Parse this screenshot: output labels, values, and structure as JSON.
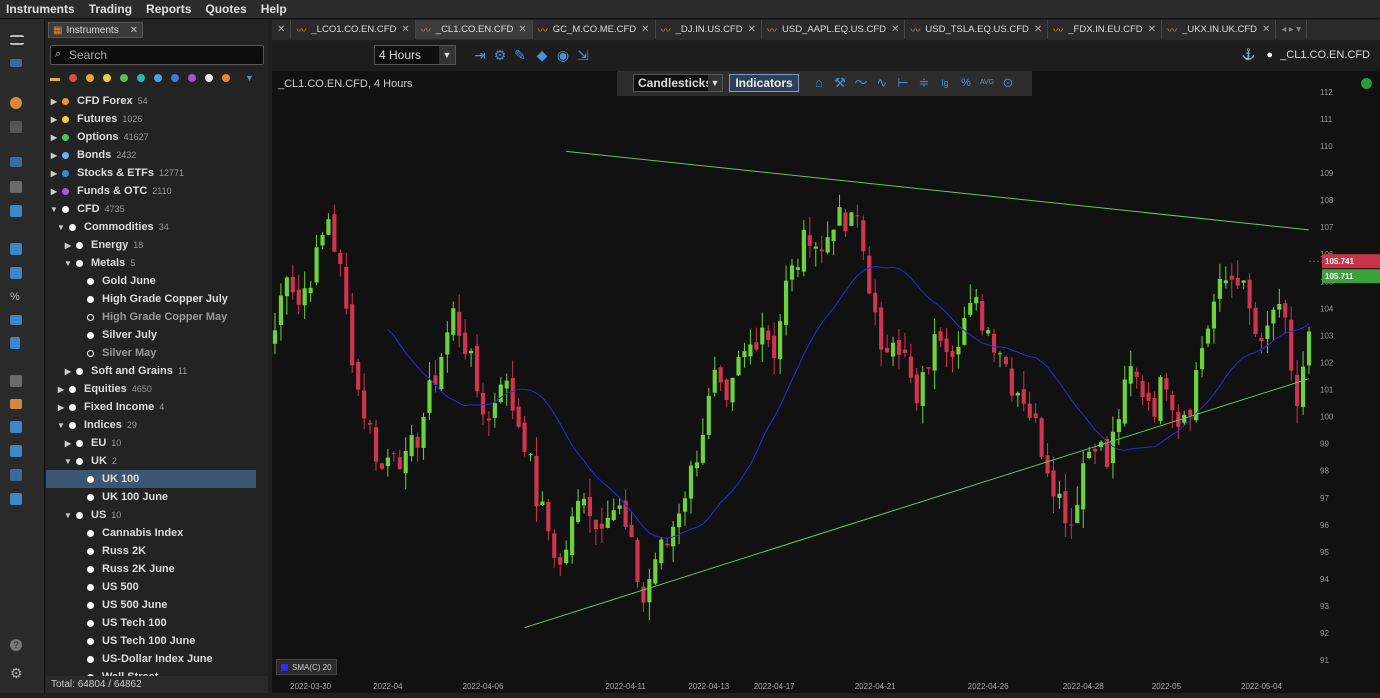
{
  "menu": [
    "Instruments",
    "Trading",
    "Reports",
    "Quotes",
    "Help"
  ],
  "panel": {
    "tab_label": "Instruments",
    "search_placeholder": "Search",
    "filter_colors": [
      "#d94f3d",
      "#e8a633",
      "#e8d133",
      "#5cb85c",
      "#2fb9a0",
      "#4aa3df",
      "#3a7fd6",
      "#a04fd6",
      "#eeeeee",
      "#e8853a"
    ],
    "tree": [
      {
        "level": 0,
        "arrow": "▶",
        "dot": "#f0902f",
        "label": "CFD Forex",
        "count": "54"
      },
      {
        "level": 0,
        "arrow": "▶",
        "dot": "#f3cf3a",
        "label": "Futures",
        "count": "1026"
      },
      {
        "level": 0,
        "arrow": "▶",
        "dot": "#4cc16a",
        "label": "Options",
        "count": "41627"
      },
      {
        "level": 0,
        "arrow": "▶",
        "dot": "#67b4ea",
        "label": "Bonds",
        "count": "2432"
      },
      {
        "level": 0,
        "arrow": "▶",
        "dot": "#3e88c9",
        "label": "Stocks & ETFs",
        "count": "12771"
      },
      {
        "level": 0,
        "arrow": "▶",
        "dot": "#b25ad6",
        "label": "Funds & OTC",
        "count": "2110"
      },
      {
        "level": 0,
        "arrow": "▼",
        "dot": "#ffffff",
        "label": "CFD",
        "count": "4735"
      },
      {
        "level": 1,
        "arrow": "▼",
        "dot": "#ffffff",
        "label": "Commodities",
        "count": "34"
      },
      {
        "level": 2,
        "arrow": "▶",
        "dot": "#ffffff",
        "label": "Energy",
        "count": "18"
      },
      {
        "level": 2,
        "arrow": "▼",
        "dot": "#ffffff",
        "label": "Metals",
        "count": "5"
      },
      {
        "level": 3,
        "arrow": "",
        "dot": "#ffffff",
        "label": "Gold June",
        "count": ""
      },
      {
        "level": 3,
        "arrow": "",
        "dot": "#ffffff",
        "label": "High Grade Copper July",
        "count": ""
      },
      {
        "level": 3,
        "arrow": "",
        "dot": "hollow",
        "label": "High Grade Copper May",
        "count": "",
        "dim": true
      },
      {
        "level": 3,
        "arrow": "",
        "dot": "#ffffff",
        "label": "Silver July",
        "count": ""
      },
      {
        "level": 3,
        "arrow": "",
        "dot": "hollow",
        "label": "Silver May",
        "count": "",
        "dim": true
      },
      {
        "level": 2,
        "arrow": "▶",
        "dot": "#ffffff",
        "label": "Soft and Grains",
        "count": "11"
      },
      {
        "level": 1,
        "arrow": "▶",
        "dot": "#ffffff",
        "label": "Equities",
        "count": "4650"
      },
      {
        "level": 1,
        "arrow": "▶",
        "dot": "#ffffff",
        "label": "Fixed Income",
        "count": "4"
      },
      {
        "level": 1,
        "arrow": "▼",
        "dot": "#ffffff",
        "label": "Indices",
        "count": "29"
      },
      {
        "level": 2,
        "arrow": "▶",
        "dot": "#ffffff",
        "label": "EU",
        "count": "10"
      },
      {
        "level": 2,
        "arrow": "▼",
        "dot": "#ffffff",
        "label": "UK",
        "count": "2"
      },
      {
        "level": 3,
        "arrow": "",
        "dot": "#ffffff",
        "label": "UK 100",
        "count": "",
        "selected": true
      },
      {
        "level": 3,
        "arrow": "",
        "dot": "#ffffff",
        "label": "UK 100 June",
        "count": ""
      },
      {
        "level": 2,
        "arrow": "▼",
        "dot": "#ffffff",
        "label": "US",
        "count": "10"
      },
      {
        "level": 3,
        "arrow": "",
        "dot": "#ffffff",
        "label": "Cannabis Index",
        "count": ""
      },
      {
        "level": 3,
        "arrow": "",
        "dot": "#ffffff",
        "label": "Russ 2K",
        "count": ""
      },
      {
        "level": 3,
        "arrow": "",
        "dot": "#ffffff",
        "label": "Russ 2K June",
        "count": ""
      },
      {
        "level": 3,
        "arrow": "",
        "dot": "#ffffff",
        "label": "US 500",
        "count": ""
      },
      {
        "level": 3,
        "arrow": "",
        "dot": "#ffffff",
        "label": "US 500 June",
        "count": ""
      },
      {
        "level": 3,
        "arrow": "",
        "dot": "#ffffff",
        "label": "US Tech 100",
        "count": ""
      },
      {
        "level": 3,
        "arrow": "",
        "dot": "#ffffff",
        "label": "US Tech 100 June",
        "count": ""
      },
      {
        "level": 3,
        "arrow": "",
        "dot": "#ffffff",
        "label": "US-Dollar Index June",
        "count": ""
      },
      {
        "level": 3,
        "arrow": "",
        "dot": "#ffffff",
        "label": "Wall Street",
        "count": ""
      }
    ],
    "total_label": "Total:",
    "total_value": "64804 / 64862"
  },
  "tabs": [
    {
      "label": "_LCO1.CO.EN.CFD",
      "active": false
    },
    {
      "label": "_CL1.CO.EN.CFD",
      "active": true
    },
    {
      "label": "GC_M.CO.ME.CFD",
      "active": false
    },
    {
      "label": "_DJ.IN.US.CFD",
      "active": false
    },
    {
      "label": "USD_AAPL.EQ.US.CFD",
      "active": false
    },
    {
      "label": "USD_TSLA.EQ.US.CFD",
      "active": false
    },
    {
      "label": "_FDX.IN.EU.CFD",
      "active": false
    },
    {
      "label": "_UKX.IN.UK.CFD",
      "active": false
    }
  ],
  "toolbar": {
    "timeframe": "4 Hours",
    "symbol": "_CL1.CO.EN.CFD",
    "chart_type": "Candlesticks",
    "indicators_label": "Indicators"
  },
  "chart_title": "_CL1.CO.EN.CFD, 4 Hours",
  "price_tags": {
    "ask": "105.741",
    "bid": "105.711"
  },
  "indicator_legend": "SMA(C) 20",
  "colors": {
    "up": "#6cd43a",
    "down": "#d0344e",
    "sma": "#2a2ae0",
    "trend": "#5ecb5e",
    "accent": "#4a8fd8"
  },
  "chart_data": {
    "type": "candlestick",
    "title": "_CL1.CO.EN.CFD, 4 Hours",
    "y_ticks": [
      91,
      92,
      93,
      94,
      95,
      96,
      97,
      98,
      99,
      100,
      101,
      102,
      103,
      104,
      105,
      106,
      107,
      108,
      109,
      110,
      111,
      112
    ],
    "ylim": [
      90.6,
      112.4
    ],
    "x_tick_labels": [
      "2022-03-30",
      "2022-04",
      "2022-04-06",
      "2022-04-11",
      "2022-04-13",
      "2022-04-17",
      "2022-04-21",
      "2022-04-26",
      "2022-04-28",
      "2022-05",
      "2022-05-04"
    ],
    "x_tick_index": [
      6,
      19,
      35,
      59,
      73,
      84,
      101,
      120,
      136,
      150,
      166
    ],
    "n_candles": 175,
    "anchors": [
      [
        0,
        103.2
      ],
      [
        2,
        105.6
      ],
      [
        4,
        104.2
      ],
      [
        7,
        105.8
      ],
      [
        9,
        107.4
      ],
      [
        11,
        105.3
      ],
      [
        12,
        103.8
      ],
      [
        14,
        101.0
      ],
      [
        16,
        99.5
      ],
      [
        18,
        98.0
      ],
      [
        20,
        99.0
      ],
      [
        22,
        98.2
      ],
      [
        24,
        99.3
      ],
      [
        26,
        100.8
      ],
      [
        28,
        102.3
      ],
      [
        30,
        103.8
      ],
      [
        32,
        102.7
      ],
      [
        34,
        101.0
      ],
      [
        36,
        99.8
      ],
      [
        38,
        101.6
      ],
      [
        40,
        100.4
      ],
      [
        42,
        99.2
      ],
      [
        44,
        97.0
      ],
      [
        46,
        95.8
      ],
      [
        48,
        94.4
      ],
      [
        50,
        96.0
      ],
      [
        52,
        97.4
      ],
      [
        54,
        95.9
      ],
      [
        56,
        96.8
      ],
      [
        58,
        96.5
      ],
      [
        60,
        95.0
      ],
      [
        62,
        93.2
      ],
      [
        64,
        94.8
      ],
      [
        66,
        95.3
      ],
      [
        68,
        96.7
      ],
      [
        70,
        97.9
      ],
      [
        72,
        99.6
      ],
      [
        74,
        101.3
      ],
      [
        76,
        100.1
      ],
      [
        78,
        101.9
      ],
      [
        80,
        102.6
      ],
      [
        82,
        103.5
      ],
      [
        84,
        102.5
      ],
      [
        86,
        104.8
      ],
      [
        88,
        105.8
      ],
      [
        90,
        106.9
      ],
      [
        92,
        106.0
      ],
      [
        94,
        107.4
      ],
      [
        96,
        106.9
      ],
      [
        98,
        107.3
      ],
      [
        100,
        105.0
      ],
      [
        102,
        102.0
      ],
      [
        104,
        103.3
      ],
      [
        106,
        102.1
      ],
      [
        108,
        100.3
      ],
      [
        110,
        102.1
      ],
      [
        112,
        103.2
      ],
      [
        114,
        102.7
      ],
      [
        116,
        103.6
      ],
      [
        118,
        104.0
      ],
      [
        120,
        103.2
      ],
      [
        122,
        102.6
      ],
      [
        124,
        101.3
      ],
      [
        126,
        100.8
      ],
      [
        128,
        99.6
      ],
      [
        130,
        98.3
      ],
      [
        132,
        97.0
      ],
      [
        134,
        96.1
      ],
      [
        136,
        98.3
      ],
      [
        138,
        99.3
      ],
      [
        140,
        98.2
      ],
      [
        142,
        100.1
      ],
      [
        144,
        101.6
      ],
      [
        146,
        101.0
      ],
      [
        148,
        100.5
      ],
      [
        150,
        101.5
      ],
      [
        152,
        100.0
      ],
      [
        154,
        100.6
      ],
      [
        156,
        102.6
      ],
      [
        158,
        104.2
      ],
      [
        160,
        105.0
      ],
      [
        162,
        105.3
      ],
      [
        164,
        103.8
      ],
      [
        166,
        102.3
      ],
      [
        168,
        104.0
      ],
      [
        170,
        103.2
      ],
      [
        172,
        100.4
      ],
      [
        174,
        102.8
      ],
      [
        176,
        103.8
      ],
      [
        178,
        103.4
      ],
      [
        180,
        102.9
      ],
      [
        182,
        102.0
      ],
      [
        184,
        102.8
      ],
      [
        186,
        105.7
      ]
    ],
    "sma_period": 20,
    "trendlines": [
      {
        "name": "resistance",
        "from": [
          49,
          109.8
        ],
        "to": [
          174,
          106.9
        ]
      },
      {
        "name": "support",
        "from": [
          42,
          92.2
        ],
        "to": [
          174,
          101.4
        ]
      }
    ],
    "last_bid": 105.711,
    "last_ask": 105.741
  }
}
